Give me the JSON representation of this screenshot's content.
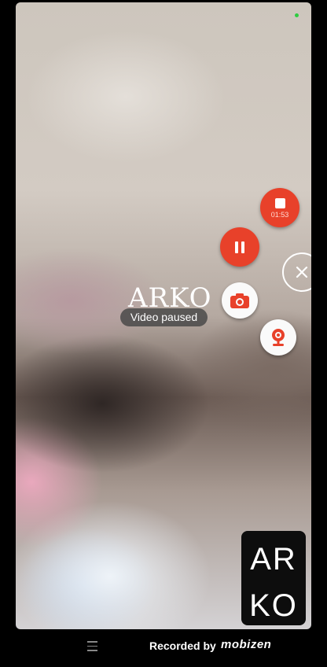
{
  "overlay": {
    "watermark": "ARKO",
    "status_text": "Video paused"
  },
  "recorder_controls": {
    "timer": "01:53",
    "buttons": [
      {
        "name": "stop",
        "icon": "stop-icon",
        "color": "#e8412a"
      },
      {
        "name": "pause",
        "icon": "pause-icon",
        "color": "#e8412a"
      },
      {
        "name": "close",
        "icon": "close-icon"
      },
      {
        "name": "screenshot",
        "icon": "camera-icon",
        "color": "#e8412a"
      },
      {
        "name": "face-cam",
        "icon": "webcam-icon",
        "color": "#e8412a"
      }
    ]
  },
  "logo_tile": {
    "line1": "AR",
    "line2": "KO"
  },
  "footer": {
    "recorded_by": "Recorded by",
    "brand": "mobizen"
  }
}
